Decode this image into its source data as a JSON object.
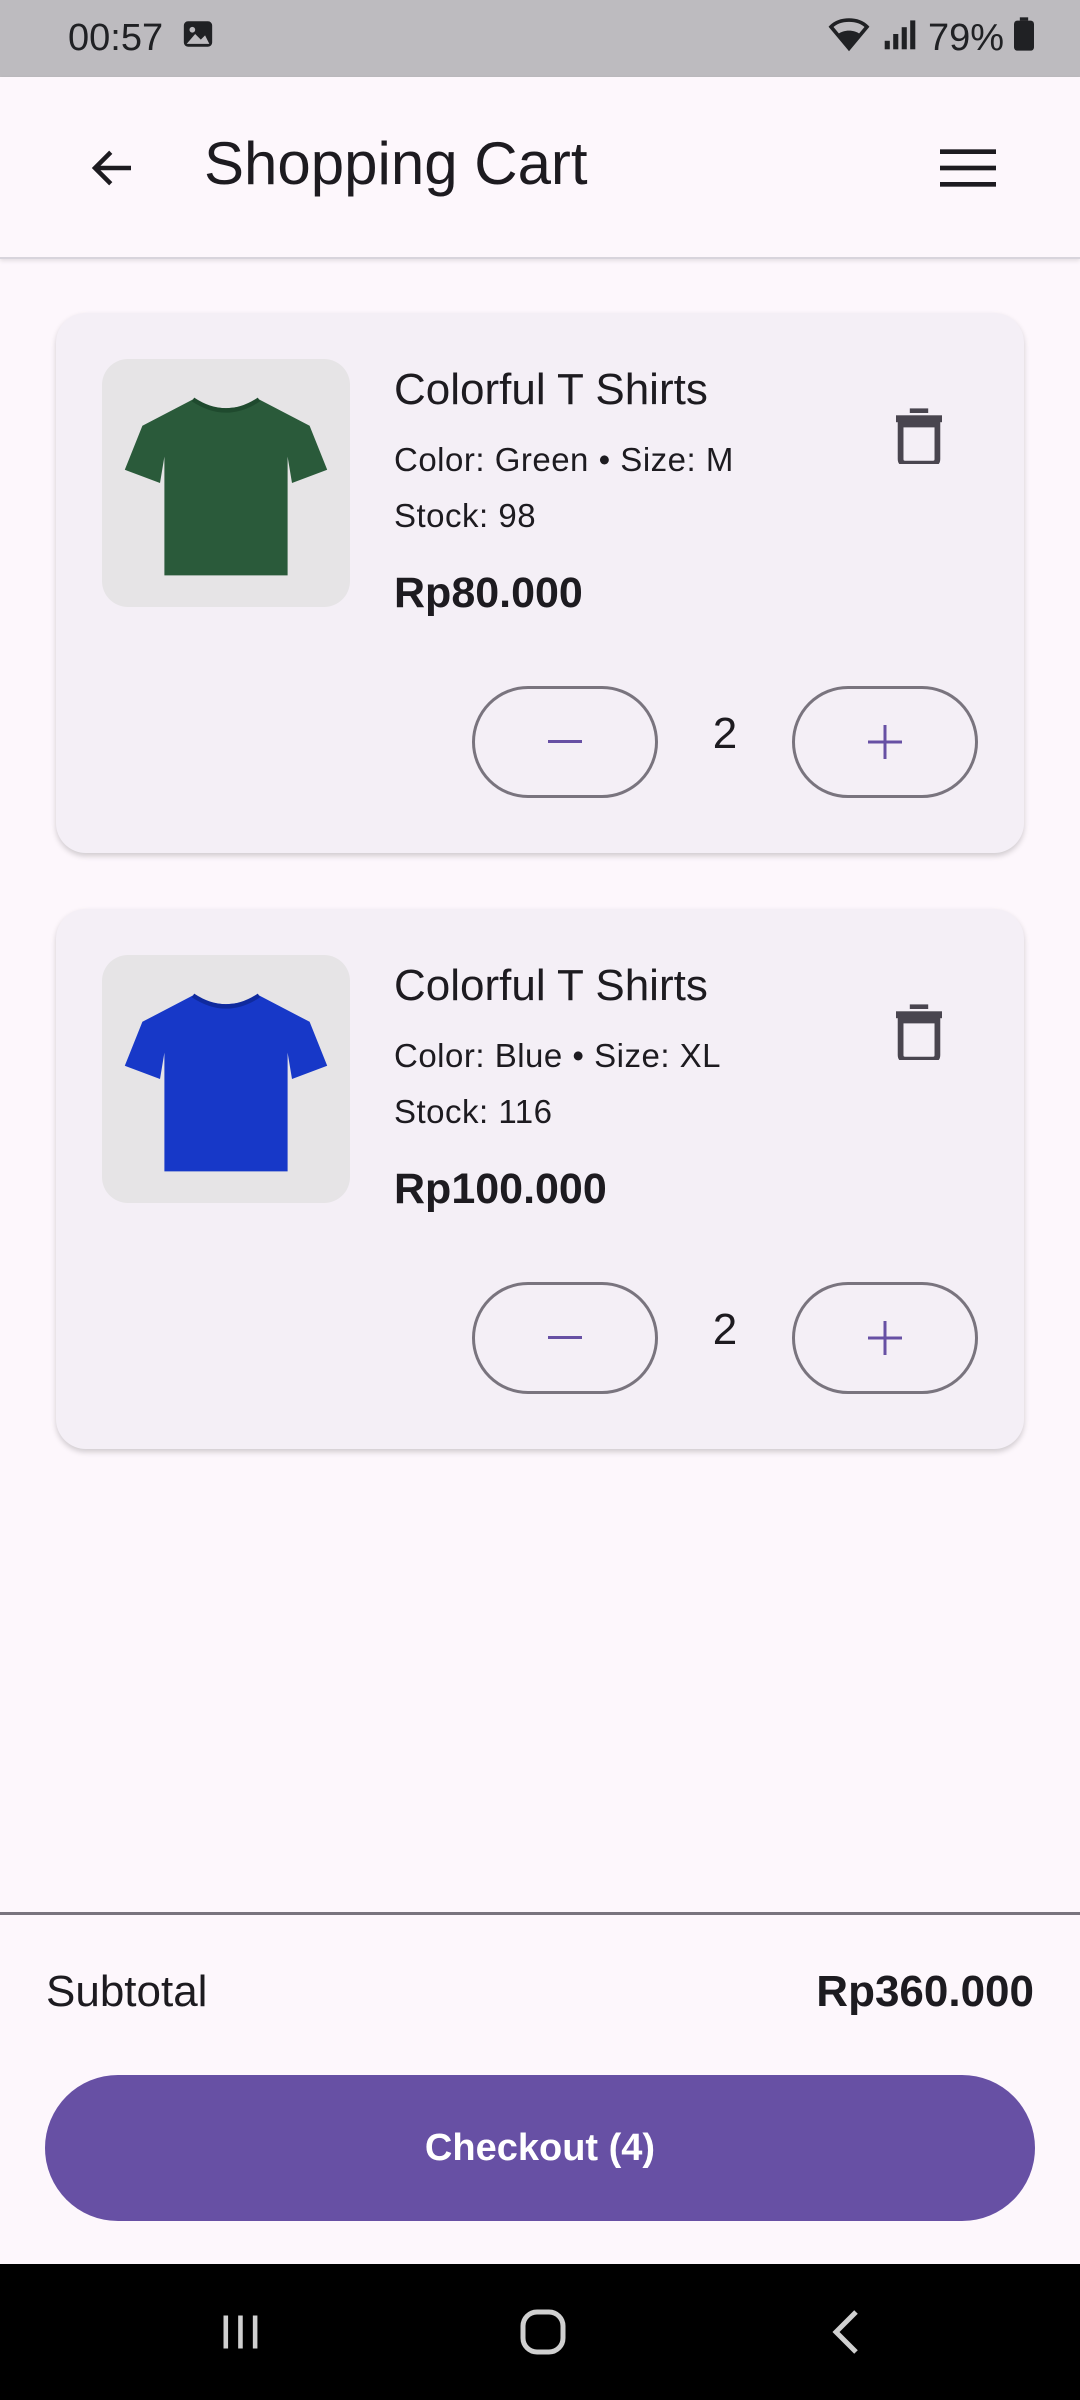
{
  "status_bar": {
    "time": "00:57",
    "battery": "79%"
  },
  "app_bar": {
    "title": "Shopping Cart"
  },
  "cart_items": [
    {
      "name": "Colorful T Shirts",
      "variant": "Color: Green • Size: M",
      "stock": "Stock: 98",
      "price": "Rp80.000",
      "quantity": "2",
      "shirt_color": "#2a5a3a"
    },
    {
      "name": "Colorful T Shirts",
      "variant": "Color: Blue • Size: XL",
      "stock": "Stock: 116",
      "price": "Rp100.000",
      "quantity": "2",
      "shirt_color": "#1738c8"
    }
  ],
  "summary": {
    "subtotal_label": "Subtotal",
    "subtotal_value": "Rp360.000",
    "checkout_label": "Checkout (4)"
  },
  "colors": {
    "accent": "#6750a4",
    "background": "#fdf7fc",
    "card": "#f4eff6"
  }
}
